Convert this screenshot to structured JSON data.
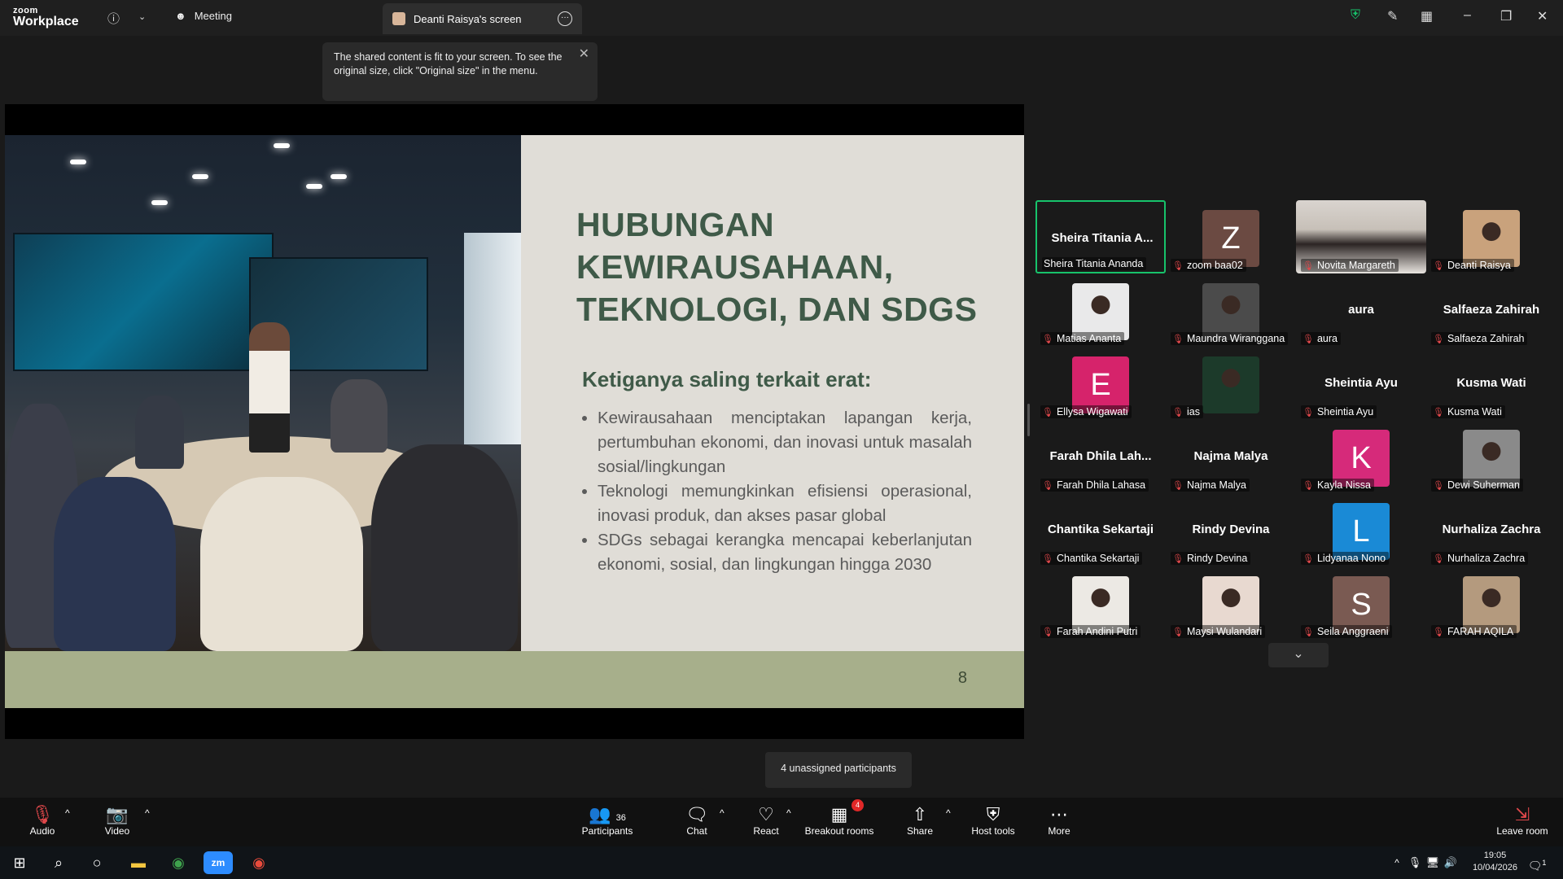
{
  "app": {
    "logo_small": "zoom",
    "logo_big": "Workplace"
  },
  "tabs": {
    "meeting": "Meeting",
    "screen": "Deanti Raisya's screen"
  },
  "tooltip": {
    "text": "The shared content is fit to your screen. To see the original size, click \"Original size\" in the menu."
  },
  "slide": {
    "title_lines": [
      "HUBUNGAN",
      "KEWIRAUSAHAAN,",
      "TEKNOLOGI, DAN SDGS"
    ],
    "subtitle": "Ketiganya saling terkait erat:",
    "bullets": [
      "Kewirausahaan menciptakan lapangan kerja, pertumbuhan ekonomi, dan inovasi untuk masalah sosial/lingkungan",
      "Teknologi memungkinkan efisiensi operasional, inovasi produk, dan akses pasar global",
      "SDGs sebagai kerangka mencapai keberlanjutan ekonomi, sosial, dan lingkungan hingga 2030"
    ],
    "page_number": "8"
  },
  "participants": [
    {
      "big": "Sheira Titania A...",
      "label": "Sheira Titania Ananda",
      "kind": "name",
      "active": true,
      "muted": false
    },
    {
      "avatar": "Z",
      "color": "#6b4a42",
      "label": "zoom baa02",
      "kind": "letter",
      "muted": true
    },
    {
      "label": "Novita Margareth",
      "kind": "video",
      "muted": true
    },
    {
      "label": "Deanti Raisya",
      "kind": "photo",
      "color": "#c9a27c",
      "muted": true
    },
    {
      "label": "Matias Ananta",
      "kind": "photo",
      "color": "#e9e9ea",
      "muted": true
    },
    {
      "label": "Maundra Wiranggana",
      "kind": "photo",
      "color": "#4b4b4b",
      "muted": true
    },
    {
      "big": "aura",
      "label": "aura",
      "kind": "name",
      "muted": true
    },
    {
      "big": "Salfaeza Zahirah",
      "label": "Salfaeza Zahirah",
      "kind": "name",
      "muted": true
    },
    {
      "avatar": "E",
      "color": "#d6236b",
      "label": "Ellysa Wigawati",
      "kind": "letter",
      "muted": true
    },
    {
      "label": "ias",
      "kind": "photo",
      "color": "#1c3a2a",
      "muted": true
    },
    {
      "big": "Sheintia Ayu",
      "label": "Sheintia Ayu",
      "kind": "name",
      "muted": true
    },
    {
      "big": "Kusma Wati",
      "label": "Kusma Wati",
      "kind": "name",
      "muted": true
    },
    {
      "big": "Farah Dhila Lah...",
      "label": "Farah Dhila Lahasa",
      "kind": "name",
      "muted": true
    },
    {
      "big": "Najma Malya",
      "label": "Najma Malya",
      "kind": "name",
      "muted": true
    },
    {
      "avatar": "K",
      "color": "#d62a7a",
      "label": "Kayla Nissa",
      "kind": "letter",
      "muted": true
    },
    {
      "label": "Dewi Suherman",
      "kind": "photo",
      "color": "#8a8a8a",
      "muted": true
    },
    {
      "big": "Chantika Sekartaji",
      "label": "Chantika Sekartaji",
      "kind": "name",
      "muted": true
    },
    {
      "big": "Rindy Devina",
      "label": "Rindy Devina",
      "kind": "name",
      "muted": true
    },
    {
      "avatar": "L",
      "color": "#1a8ad6",
      "label": "Lidyanaa Nono",
      "kind": "letter",
      "muted": true
    },
    {
      "big": "Nurhaliza Zachra",
      "label": "Nurhaliza Zachra",
      "kind": "name",
      "muted": true
    },
    {
      "label": "Farah Andini Putri",
      "kind": "photo",
      "color": "#ece9e4",
      "muted": true
    },
    {
      "label": "Maysi Wulandari",
      "kind": "photo",
      "color": "#e8d9d0",
      "muted": true
    },
    {
      "avatar": "S",
      "color": "#7a5a52",
      "label": "Seila Anggraeni",
      "kind": "letter",
      "muted": true
    },
    {
      "label": "FARAH AQILA",
      "kind": "photo",
      "color": "#b49a7e",
      "muted": true
    }
  ],
  "unassigned": "4 unassigned participants",
  "toolbar": {
    "audio": "Audio",
    "video": "Video",
    "participants": "Participants",
    "participants_count": "36",
    "chat": "Chat",
    "react": "React",
    "breakout": "Breakout rooms",
    "breakout_badge": "4",
    "share": "Share",
    "host_tools": "Host tools",
    "more": "More",
    "leave": "Leave room"
  },
  "taskbar": {
    "time": "19:05",
    "date": "10/04/2026",
    "notifications": "1"
  },
  "icons": {
    "info": "info-icon",
    "shield": "shield-icon",
    "pen": "pen-icon",
    "layout": "layout-icon",
    "mic_muted_color": "#e0484b",
    "active_border_color": "#17c36b"
  }
}
